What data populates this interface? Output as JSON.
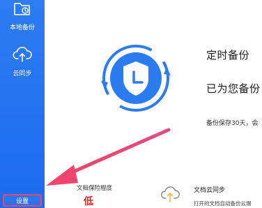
{
  "sidebar": {
    "items": [
      {
        "label": "本地备份",
        "icon": "folder-backup-icon"
      },
      {
        "label": "云同步",
        "icon": "cloud-upload-icon"
      }
    ],
    "settings_label": "设置"
  },
  "main": {
    "title": "定时备份",
    "subtitle": "已为您备份",
    "retention": "备份保存30天，会",
    "protection": {
      "label": "文档保险程度",
      "level": "低"
    },
    "cloud_sync": {
      "title": "文档云同步",
      "description": "打开的文档自动备份云端"
    }
  },
  "colors": {
    "sidebar_bg": "#1c6bed",
    "accent": "#2b7cf0",
    "highlight": "#f0436e",
    "level_low": "#ee2222"
  }
}
